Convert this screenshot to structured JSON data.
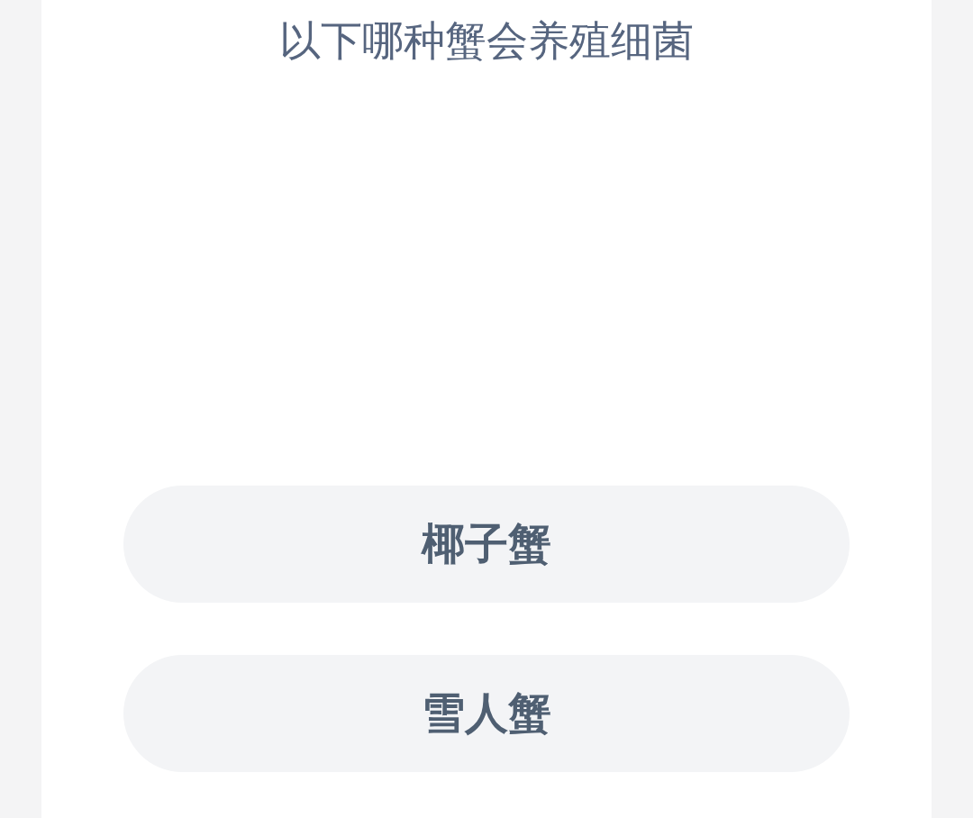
{
  "question": "以下哪种蟹会养殖细菌",
  "options": [
    {
      "label": "椰子蟹"
    },
    {
      "label": "雪人蟹"
    }
  ]
}
